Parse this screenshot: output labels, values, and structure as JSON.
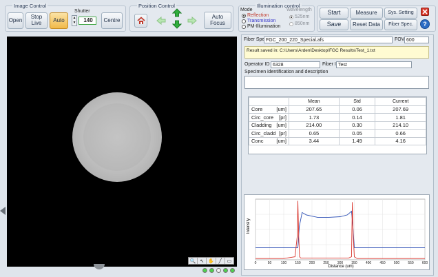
{
  "image_control": {
    "legend": "Image Control",
    "open": "Open",
    "stop_live": "Stop Live",
    "auto": "Auto",
    "shutter_label": "Shutter",
    "shutter_value": "140",
    "centre": "Centre"
  },
  "position_control": {
    "legend": "Position Control",
    "auto_focus": "Auto Focus"
  },
  "illumination": {
    "legend": "Illumination control",
    "mode_label": "Mode",
    "modes": [
      "Reflection",
      "Transmission",
      "PM-Illumination"
    ],
    "wavelength_label": "Wavelength",
    "wavelengths": [
      "525nm",
      "850nm"
    ],
    "colors": {
      "reflection": "#c0392b",
      "transmission": "#2d2dc8",
      "default": "#1a1a1a"
    }
  },
  "toolbar": {
    "start": "Start",
    "save": "Save",
    "measure": "Measure",
    "reset_data": "Reset Data",
    "sys_setting": "Sys. Setting",
    "fiber_spec": "Fiber Spec."
  },
  "fiber_spec": {
    "label": "Fiber Spec",
    "value": "FGC_200_220_Special.afs",
    "fov_label": "FOV",
    "fov_value": "600"
  },
  "result_saved": "Result saved in: C:\\Users\\Arden\\Desktop\\FGC Results\\Test_1.txt",
  "operator": {
    "label": "Operator ID",
    "value": "6328"
  },
  "fiber_id": {
    "label": "Fiber ID",
    "value": "Test"
  },
  "specimen_label": "Specimen identification and description",
  "results_table": {
    "headers": [
      "Mean",
      "Std",
      "Current"
    ],
    "rows": [
      {
        "name": "Core",
        "unit": "[um]",
        "mean": "207.65",
        "std": "0.06",
        "current": "207.69"
      },
      {
        "name": "Circ_core",
        "unit": "[pr]",
        "mean": "1.73",
        "std": "0.14",
        "current": "1.81"
      },
      {
        "name": "Cladding",
        "unit": "[um]",
        "mean": "214.00",
        "std": "0.30",
        "current": "214.10"
      },
      {
        "name": "Circ_cladd",
        "unit": "[pr]",
        "mean": "0.65",
        "std": "0.05",
        "current": "0.66"
      },
      {
        "name": "Conc",
        "unit": "[um]",
        "mean": "3.44",
        "std": "1.49",
        "current": "4.16"
      }
    ]
  },
  "chart_data": {
    "type": "line",
    "xlabel": "Distance (um)",
    "ylabel": "Intensity",
    "xlim": [
      0,
      600
    ],
    "xticks": [
      0,
      50,
      100,
      150,
      200,
      250,
      300,
      350,
      400,
      450,
      500,
      550,
      600
    ],
    "ylim": [
      0,
      1
    ],
    "grid": true,
    "series": [
      {
        "color": "#2c4fb5",
        "x": [
          0,
          100,
          150,
          155,
          165,
          180,
          220,
          260,
          300,
          325,
          340,
          345,
          350,
          400,
          500,
          600
        ],
        "y": [
          0.2,
          0.2,
          0.2,
          0.55,
          0.78,
          0.74,
          0.7,
          0.7,
          0.71,
          0.74,
          0.8,
          0.55,
          0.2,
          0.2,
          0.2,
          0.2
        ]
      },
      {
        "color": "#d9342b",
        "x": [
          0,
          100,
          140,
          148,
          150,
          153,
          156,
          160,
          330,
          340,
          343,
          346,
          350,
          360,
          400,
          500,
          600
        ],
        "y": [
          0.02,
          0.02,
          0.05,
          0.4,
          0.97,
          0.4,
          0.05,
          0.03,
          0.03,
          0.05,
          0.95,
          0.4,
          0.05,
          0.02,
          0.02,
          0.02,
          0.02
        ]
      }
    ]
  }
}
